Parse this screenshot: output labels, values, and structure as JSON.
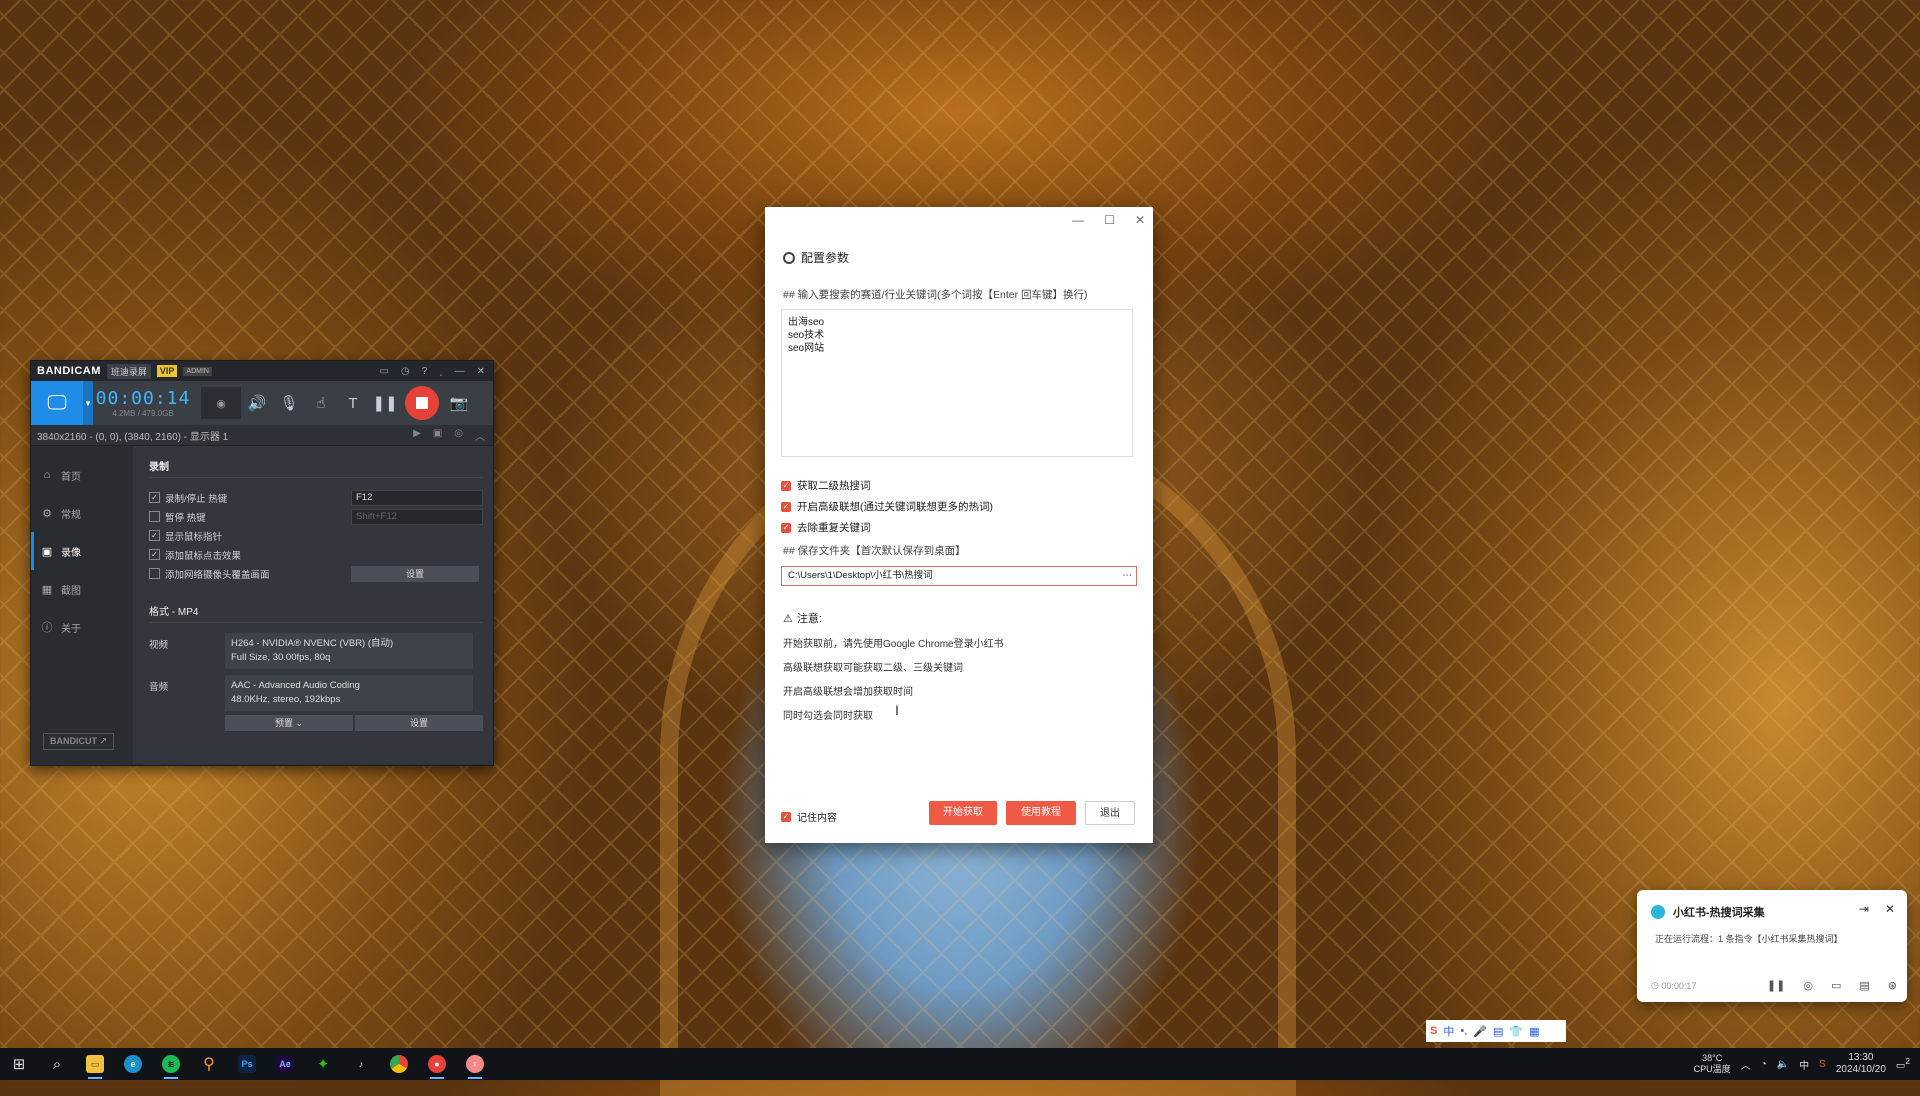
{
  "bandicam": {
    "logo": "BANDICAM",
    "tag": "班迪录屏",
    "vip": "VIP",
    "admin": "ADMIN",
    "timer": "00:00:14",
    "size": "4.2MB / 479.0GB",
    "info": "3840x2160 - (0, 0), (3840, 2160) - 显示器 1",
    "nav": [
      {
        "label": "首页",
        "icon": "⌂"
      },
      {
        "label": "常规",
        "icon": "⚙"
      },
      {
        "label": "录像",
        "icon": "▣"
      },
      {
        "label": "截图",
        "icon": "▦"
      },
      {
        "label": "关于",
        "icon": "ⓘ"
      }
    ],
    "section_title": "录制",
    "options": [
      {
        "label": "录制/停止 热键",
        "checked": true,
        "key": "F12"
      },
      {
        "label": "暂停 热键",
        "checked": false,
        "key": "Shift+F12"
      },
      {
        "label": "显示鼠标指针",
        "checked": true
      },
      {
        "label": "添加鼠标点击效果",
        "checked": true
      },
      {
        "label": "添加网络摄像头覆盖画面",
        "checked": false,
        "button": "设置"
      }
    ],
    "format_title": "格式 - MP4",
    "video_label": "视频",
    "video_line1": "H264 - NVIDIA® NVENC (VBR) (自动)",
    "video_line2": "Full Size, 30.00fps, 80q",
    "audio_label": "音频",
    "audio_line1": "AAC - Advanced Audio Coding",
    "audio_line2": "48.0KHz, stereo, 192kbps",
    "preset_button": "预置",
    "settings_button": "设置",
    "bandicut": "BANDICUT ↗"
  },
  "dialog": {
    "title": "配置参数",
    "keyword_label": "## 输入要搜索的赛道/行业关键词(多个词按【Enter 回车键】换行)",
    "keywords": "出海seo\nseo技术\nseo网站",
    "checks": [
      {
        "label": "获取二级热搜词",
        "checked": true
      },
      {
        "label": "开启高级联想(通过关键词联想更多的热词)",
        "checked": true
      },
      {
        "label": "去除重复关键词",
        "checked": true
      }
    ],
    "save_label": "## 保存文件夹【首次默认保存到桌面】",
    "save_path": "C:\\Users\\1\\Desktop\\小红书\\热搜词",
    "note_title": "注意:",
    "notes": [
      "开始获取前，请先使用Google Chrome登录小红书",
      "高级联想获取可能获取二级、三级关键词",
      "开启高级联想会增加获取时间",
      "同时勾选会同时获取"
    ],
    "remember": "记住内容",
    "btn_start": "开始获取",
    "btn_tutorial": "使用教程",
    "btn_exit": "退出"
  },
  "notification": {
    "title": "小红书-热搜词采集",
    "message": "正在运行流程：1 条指令【小红书采集热搜词】",
    "elapsed": "00:00:17"
  },
  "ime": {
    "items": [
      "中",
      "•,",
      "🎤",
      "▤",
      "👕",
      "▦"
    ]
  },
  "taskbar": {
    "temp": "38°C",
    "cpu": "CPU温度",
    "time": "13:30",
    "date": "2024/10/20",
    "lang": "中",
    "badge": "2"
  }
}
